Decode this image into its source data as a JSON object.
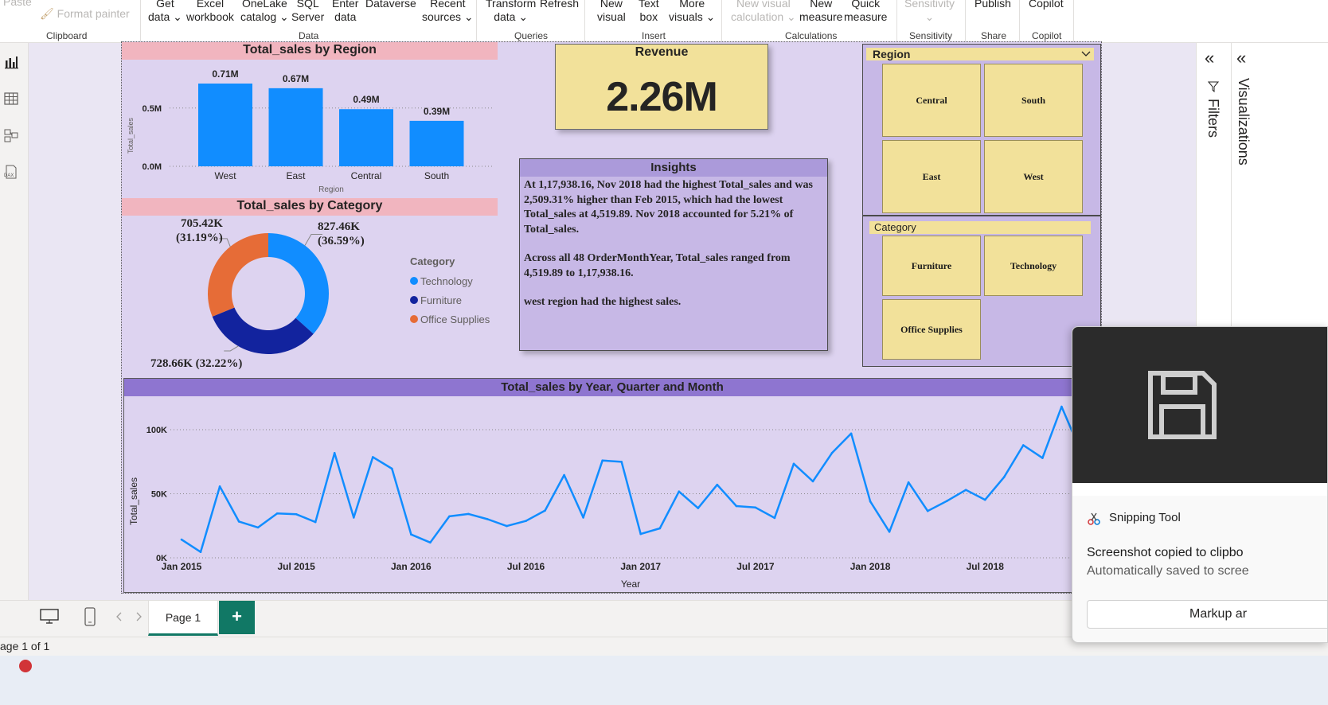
{
  "ribbon": {
    "items": [
      {
        "label": "Paste",
        "dim": true
      },
      {
        "label": "Format painter",
        "dim": true
      },
      {
        "label": "Get\ndata ⌄"
      },
      {
        "label": "Excel\nworkbook"
      },
      {
        "label": "OneLake\ncatalog ⌄"
      },
      {
        "label": "SQL\nServer"
      },
      {
        "label": "Enter\ndata"
      },
      {
        "label": "Dataverse"
      },
      {
        "label": "Recent\nsources ⌄"
      },
      {
        "label": "Transform\ndata ⌄"
      },
      {
        "label": "Refresh"
      },
      {
        "label": "New\nvisual"
      },
      {
        "label": "Text\nbox"
      },
      {
        "label": "More\nvisuals ⌄"
      },
      {
        "label": "New visual\ncalculation ⌄",
        "dim": true
      },
      {
        "label": "New\nmeasure"
      },
      {
        "label": "Quick\nmeasure"
      },
      {
        "label": "Sensitivity\n⌄",
        "dim": true
      },
      {
        "label": "Publish"
      },
      {
        "label": "Copilot"
      }
    ],
    "groups": [
      "Clipboard",
      "Data",
      "Queries",
      "Insert",
      "Calculations",
      "Sensitivity",
      "Share",
      "Copilot"
    ]
  },
  "region_chart": {
    "title": "Total_sales by Region",
    "xlabel": "Region",
    "ylabel": "Total_sales",
    "ytick_labels": [
      "0.0M",
      "0.5M"
    ]
  },
  "category_chart": {
    "title": "Total_sales by Category",
    "legend_title": "Category"
  },
  "revenue_card": {
    "title": "Revenue",
    "value": "2.26M"
  },
  "insights": {
    "title": "Insights",
    "para1": "At 1,17,938.16, Nov 2018 had the highest Total_sales and was 2,509.31% higher than Feb 2015, which had the lowest Total_sales at 4,519.89. Nov 2018 accounted for 5.21% of Total_sales.",
    "para2": "Across all 48 OrderMonthYear, Total_sales ranged from 4,519.89 to 1,17,938.16.",
    "para3": "west region had the highest sales."
  },
  "region_slicer": {
    "title": "Region",
    "options": [
      "Central",
      "South",
      "East",
      "West"
    ]
  },
  "category_slicer": {
    "title": "Category",
    "options": [
      "Furniture",
      "Technology",
      "Office Supplies"
    ]
  },
  "timeline_chart": {
    "title": "Total_sales by Year, Quarter and Month",
    "xlabel": "Year",
    "ylabel": "Total_sales"
  },
  "right_panes": {
    "filters": "Filters",
    "visualizations": "Visualizations",
    "collapse_glyph": "«"
  },
  "tabs": {
    "page1": "Page 1",
    "add": "+"
  },
  "status": {
    "page_info": "age 1 of 1"
  },
  "toast": {
    "app": "Snipping Tool",
    "line1": "Screenshot copied to clipbo",
    "line2": "Automatically saved to scree",
    "button": "Markup ar"
  },
  "colors": {
    "bar_blue": "#118dff",
    "dark_blue": "#12239e",
    "orange": "#e66c37",
    "title_pink": "#f1b5bf",
    "slicer_yellow": "#f2e19a",
    "page_purple": "#ddd3f0",
    "header_purple": "#8e75d0",
    "accent_green": "#117865"
  },
  "chart_data": [
    {
      "type": "bar",
      "title": "Total_sales by Region",
      "xlabel": "Region",
      "ylabel": "Total_sales",
      "categories": [
        "West",
        "East",
        "Central",
        "South"
      ],
      "values": [
        0.71,
        0.67,
        0.49,
        0.39
      ],
      "data_labels": [
        "0.71M",
        "0.67M",
        "0.49M",
        "0.39M"
      ],
      "ylim": [
        0,
        0.71
      ],
      "grid": true
    },
    {
      "type": "pie",
      "title": "Total_sales by Category",
      "legend_title": "Category",
      "legend_position": "right",
      "categories": [
        "Technology",
        "Furniture",
        "Office Supplies"
      ],
      "values": [
        827.46,
        728.66,
        705.42
      ],
      "data_labels": [
        "827.46K (36.59%)",
        "728.66K (32.22%)",
        "705.42K (31.19%)"
      ],
      "colors": [
        "#118dff",
        "#12239e",
        "#e66c37"
      ]
    },
    {
      "type": "line",
      "title": "Total_sales by Year, Quarter and Month",
      "xlabel": "Year",
      "ylabel": "Total_sales",
      "x_start": "Jan 2015",
      "x_tick_labels": [
        "Jan 2015",
        "Jul 2015",
        "Jan 2016",
        "Jul 2016",
        "Jan 2017",
        "Jul 2017",
        "Jan 2018",
        "Jul 2018"
      ],
      "ytick_labels": [
        "0K",
        "50K",
        "100K"
      ],
      "ylim": [
        0,
        100000
      ],
      "values": [
        14237,
        4520,
        55691,
        28295,
        23648,
        34595,
        33946,
        27909,
        81777,
        31453,
        78629,
        69546,
        18174,
        11951,
        32339,
        34195,
        30132,
        24797,
        28765,
        36899,
        64596,
        31405,
        75973,
        74920,
        18542,
        22979,
        51716,
        38750,
        56988,
        40344,
        39262,
        31115,
        73410,
        59688,
        81777,
        96999,
        43971,
        20301,
        58872,
        36521,
        44261,
        52981,
        45264,
        63121,
        87867,
        77907,
        117938,
        83030
      ],
      "grid": true
    }
  ]
}
